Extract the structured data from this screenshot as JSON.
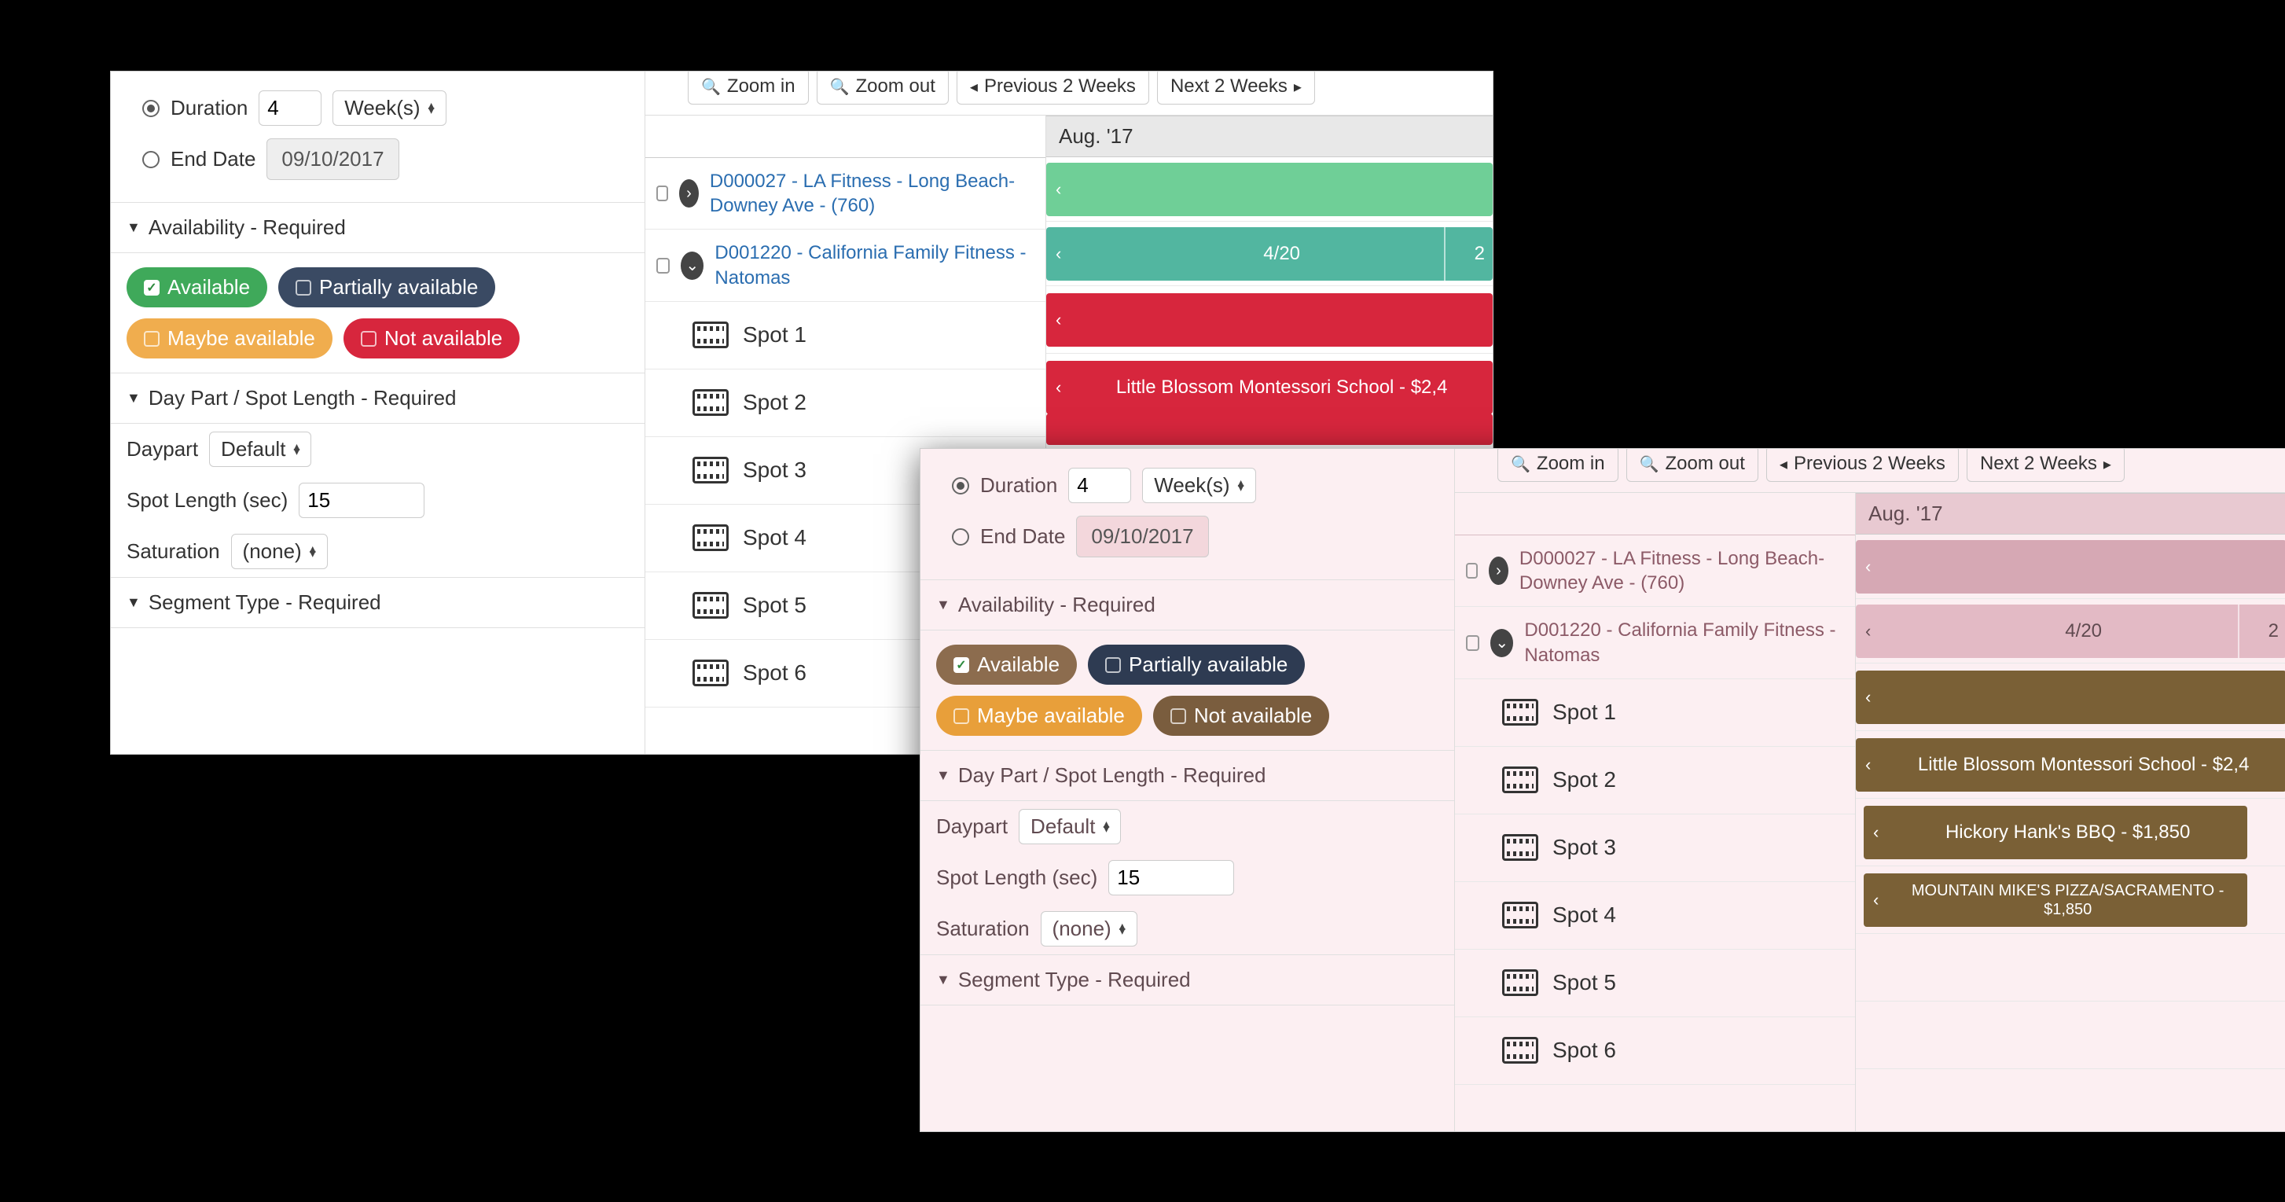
{
  "panelA": {
    "sidebar": {
      "duration_label": "Duration",
      "duration_value": "4",
      "duration_unit": "Week(s)",
      "enddate_label": "End Date",
      "enddate_value": "09/10/2017",
      "availability_header": "Availability - Required",
      "pills": {
        "available": "Available",
        "partial": "Partially available",
        "maybe": "Maybe available",
        "not": "Not available"
      },
      "daypart_header": "Day Part / Spot Length - Required",
      "daypart_label": "Daypart",
      "daypart_value": "Default",
      "spotlength_label": "Spot Length (sec)",
      "spotlength_value": "15",
      "saturation_label": "Saturation",
      "saturation_value": "(none)",
      "segment_header": "Segment Type - Required"
    },
    "toolbar": {
      "zoom_in": "Zoom in",
      "zoom_out": "Zoom out",
      "prev": "Previous 2 Weeks",
      "next": "Next 2 Weeks"
    },
    "month": "Aug. '17",
    "deals": [
      {
        "label": "D000027 - LA Fitness - Long Beach-Downey Ave - (760)",
        "expander": "right"
      },
      {
        "label": "D001220 - California Family Fitness - Natomas",
        "expander": "down",
        "bar_center": "4/20",
        "bar_right": "2"
      }
    ],
    "spots": [
      {
        "label": "Spot 1",
        "bar": ""
      },
      {
        "label": "Spot 2",
        "bar": "Little Blossom Montessori School -  $2,4"
      },
      {
        "label": "Spot 3",
        "bar": ""
      },
      {
        "label": "Spot 4",
        "bar": ""
      },
      {
        "label": "Spot 5",
        "bar": ""
      },
      {
        "label": "Spot 6",
        "bar": ""
      }
    ]
  },
  "panelB": {
    "sidebar": {
      "duration_label": "Duration",
      "duration_value": "4",
      "duration_unit": "Week(s)",
      "enddate_label": "End Date",
      "enddate_value": "09/10/2017",
      "availability_header": "Availability - Required",
      "pills": {
        "available": "Available",
        "partial": "Partially available",
        "maybe": "Maybe available",
        "not": "Not available"
      },
      "daypart_header": "Day Part / Spot Length - Required",
      "daypart_label": "Daypart",
      "daypart_value": "Default",
      "spotlength_label": "Spot Length (sec)",
      "spotlength_value": "15",
      "saturation_label": "Saturation",
      "saturation_value": "(none)",
      "segment_header": "Segment Type - Required"
    },
    "toolbar": {
      "zoom_in": "Zoom in",
      "zoom_out": "Zoom out",
      "prev": "Previous 2 Weeks",
      "next": "Next 2 Weeks"
    },
    "month": "Aug. '17",
    "deals": [
      {
        "label": "D000027 - LA Fitness - Long Beach-Downey Ave - (760)",
        "expander": "right"
      },
      {
        "label": "D001220 - California Family Fitness - Natomas",
        "expander": "down",
        "bar_center": "4/20",
        "bar_right": "2"
      }
    ],
    "spots": [
      {
        "label": "Spot 1",
        "bar": ""
      },
      {
        "label": "Spot 2",
        "bar": "Little Blossom Montessori School -  $2,4"
      },
      {
        "label": "Spot 3",
        "bar": "Hickory Hank's BBQ -  $1,850"
      },
      {
        "label": "Spot 4",
        "bar": "MOUNTAIN MIKE'S PIZZA/SACRAMENTO -  $1,850"
      },
      {
        "label": "Spot 5",
        "bar": ""
      },
      {
        "label": "Spot 6",
        "bar": ""
      }
    ]
  }
}
